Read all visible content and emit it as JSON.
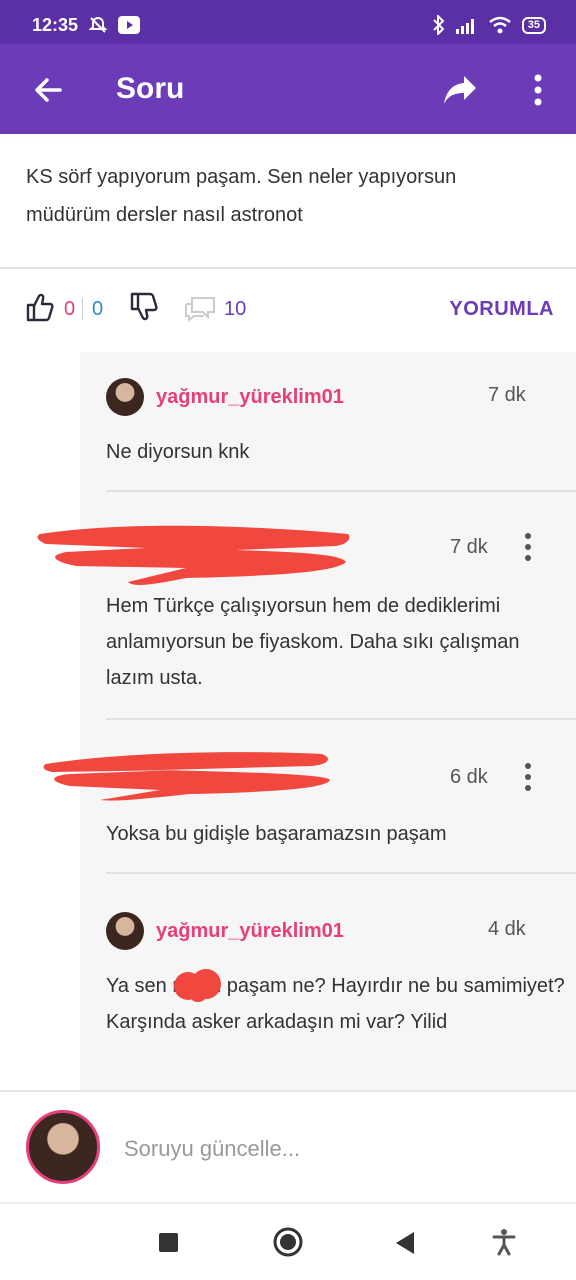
{
  "status_bar": {
    "time": "12:35",
    "battery": "35",
    "icons": [
      "do-not-disturb-icon",
      "youtube-icon",
      "bluetooth-icon",
      "signal-icon",
      "wifi-icon",
      "battery-icon"
    ]
  },
  "app_bar": {
    "title": "Soru",
    "icons": [
      "back-arrow-icon",
      "share-icon",
      "more-vert-icon"
    ]
  },
  "question": {
    "text": "KS sörf yapıyorum paşam. Sen neler yapıyorsun müdürüm dersler nasıl astronot"
  },
  "actions": {
    "likes_a": "0",
    "likes_b": "0",
    "comments_count": "10",
    "comment_button": "YORUMLA"
  },
  "comments": [
    {
      "username": "yağmur_yüreklim01",
      "time": "7 dk",
      "body": "Ne diyorsun knk"
    },
    {
      "username": "",
      "time": "7 dk",
      "body": "Hem Türkçe çalışıyorsun hem de dediklerimi anlamıyorsun be fiyaskom. Daha sıkı çalışman lazım usta."
    },
    {
      "username": "",
      "time": "6 dk",
      "body": "Yoksa bu gidişle başaramazsın paşam"
    },
    {
      "username": "yağmur_yüreklim01",
      "time": "4 dk",
      "body": "Ya sen       mısın paşam ne? Hayırdır ne bu samimiyet? Karşında asker arkadaşın mi var? Yilid"
    }
  ],
  "compose": {
    "placeholder": "Soruyu güncelle..."
  },
  "colors": {
    "status_bar": "#5b2fa6",
    "app_bar": "#6b3bb8",
    "accent_pink": "#e6407a",
    "accent_blue": "#2f8ccf",
    "redaction": "#f0473f"
  }
}
